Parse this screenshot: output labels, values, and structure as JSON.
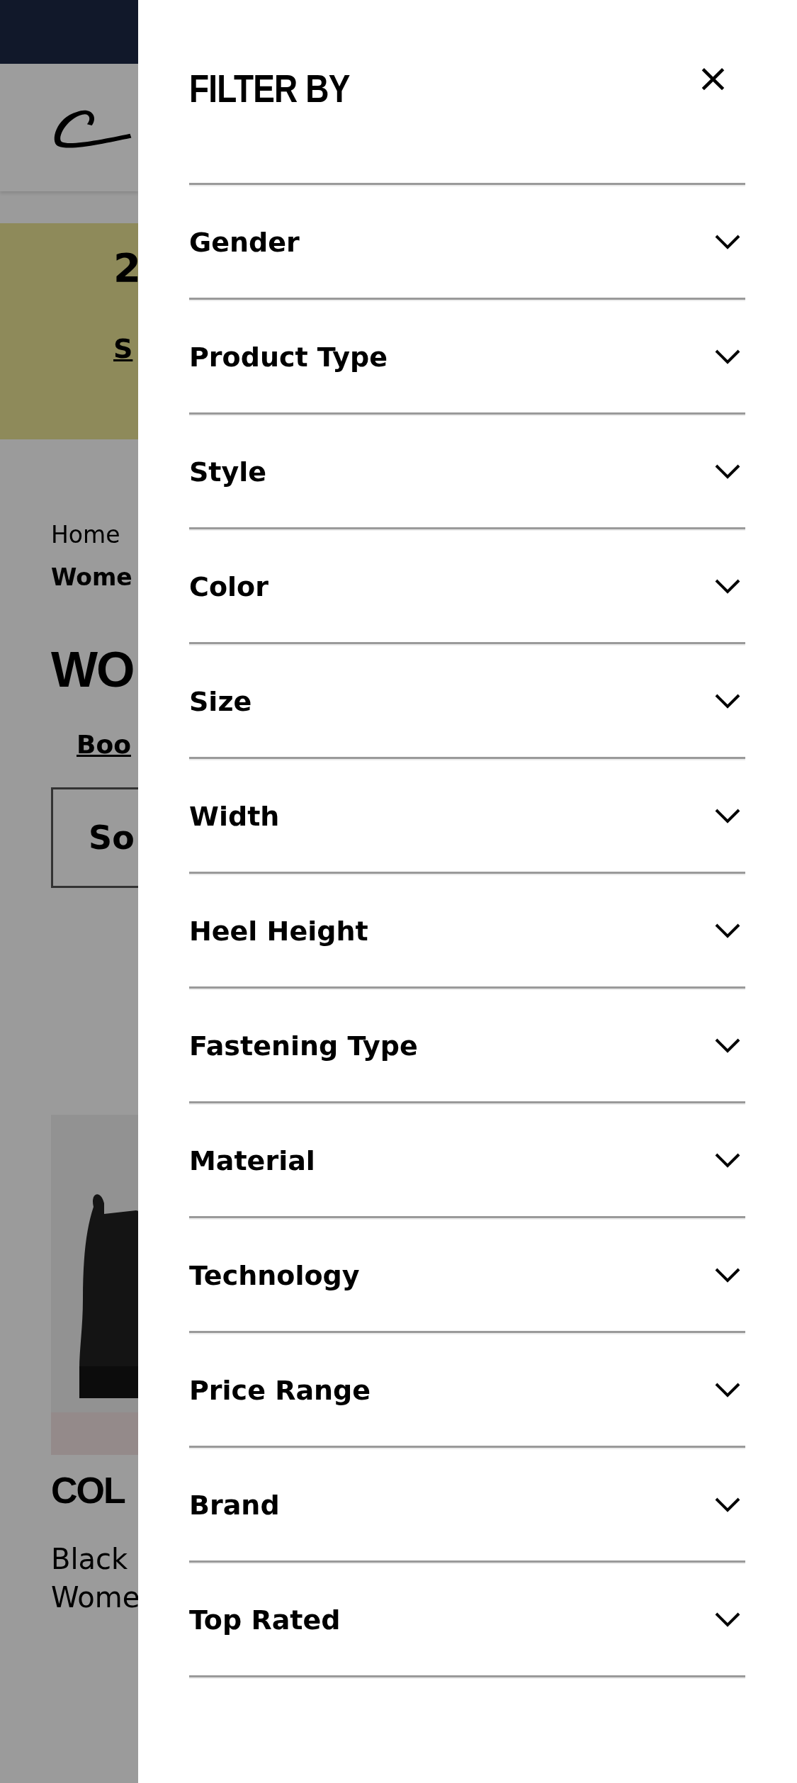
{
  "background": {
    "banner_heading": "2",
    "banner_link": "S",
    "breadcrumb": [
      "Home",
      "Wome"
    ],
    "page_title": "WO",
    "category_link": "Boo",
    "sort_button": "So",
    "product": {
      "name": "COL",
      "lines": [
        "Black",
        "Wome"
      ]
    }
  },
  "filter_panel": {
    "title": "FILTER BY",
    "close": "×",
    "filters": [
      {
        "label": "Gender",
        "expanded": false
      },
      {
        "label": "Product Type",
        "expanded": false
      },
      {
        "label": "Style",
        "expanded": false
      },
      {
        "label": "Color",
        "expanded": false
      },
      {
        "label": "Size",
        "expanded": false
      },
      {
        "label": "Width",
        "expanded": false
      },
      {
        "label": "Heel Height",
        "expanded": false
      },
      {
        "label": "Fastening Type",
        "expanded": false
      },
      {
        "label": "Material",
        "expanded": false
      },
      {
        "label": "Technology",
        "expanded": false
      },
      {
        "label": "Price Range",
        "expanded": false
      },
      {
        "label": "Brand",
        "expanded": false
      },
      {
        "label": "Top Rated",
        "expanded": false
      }
    ]
  }
}
